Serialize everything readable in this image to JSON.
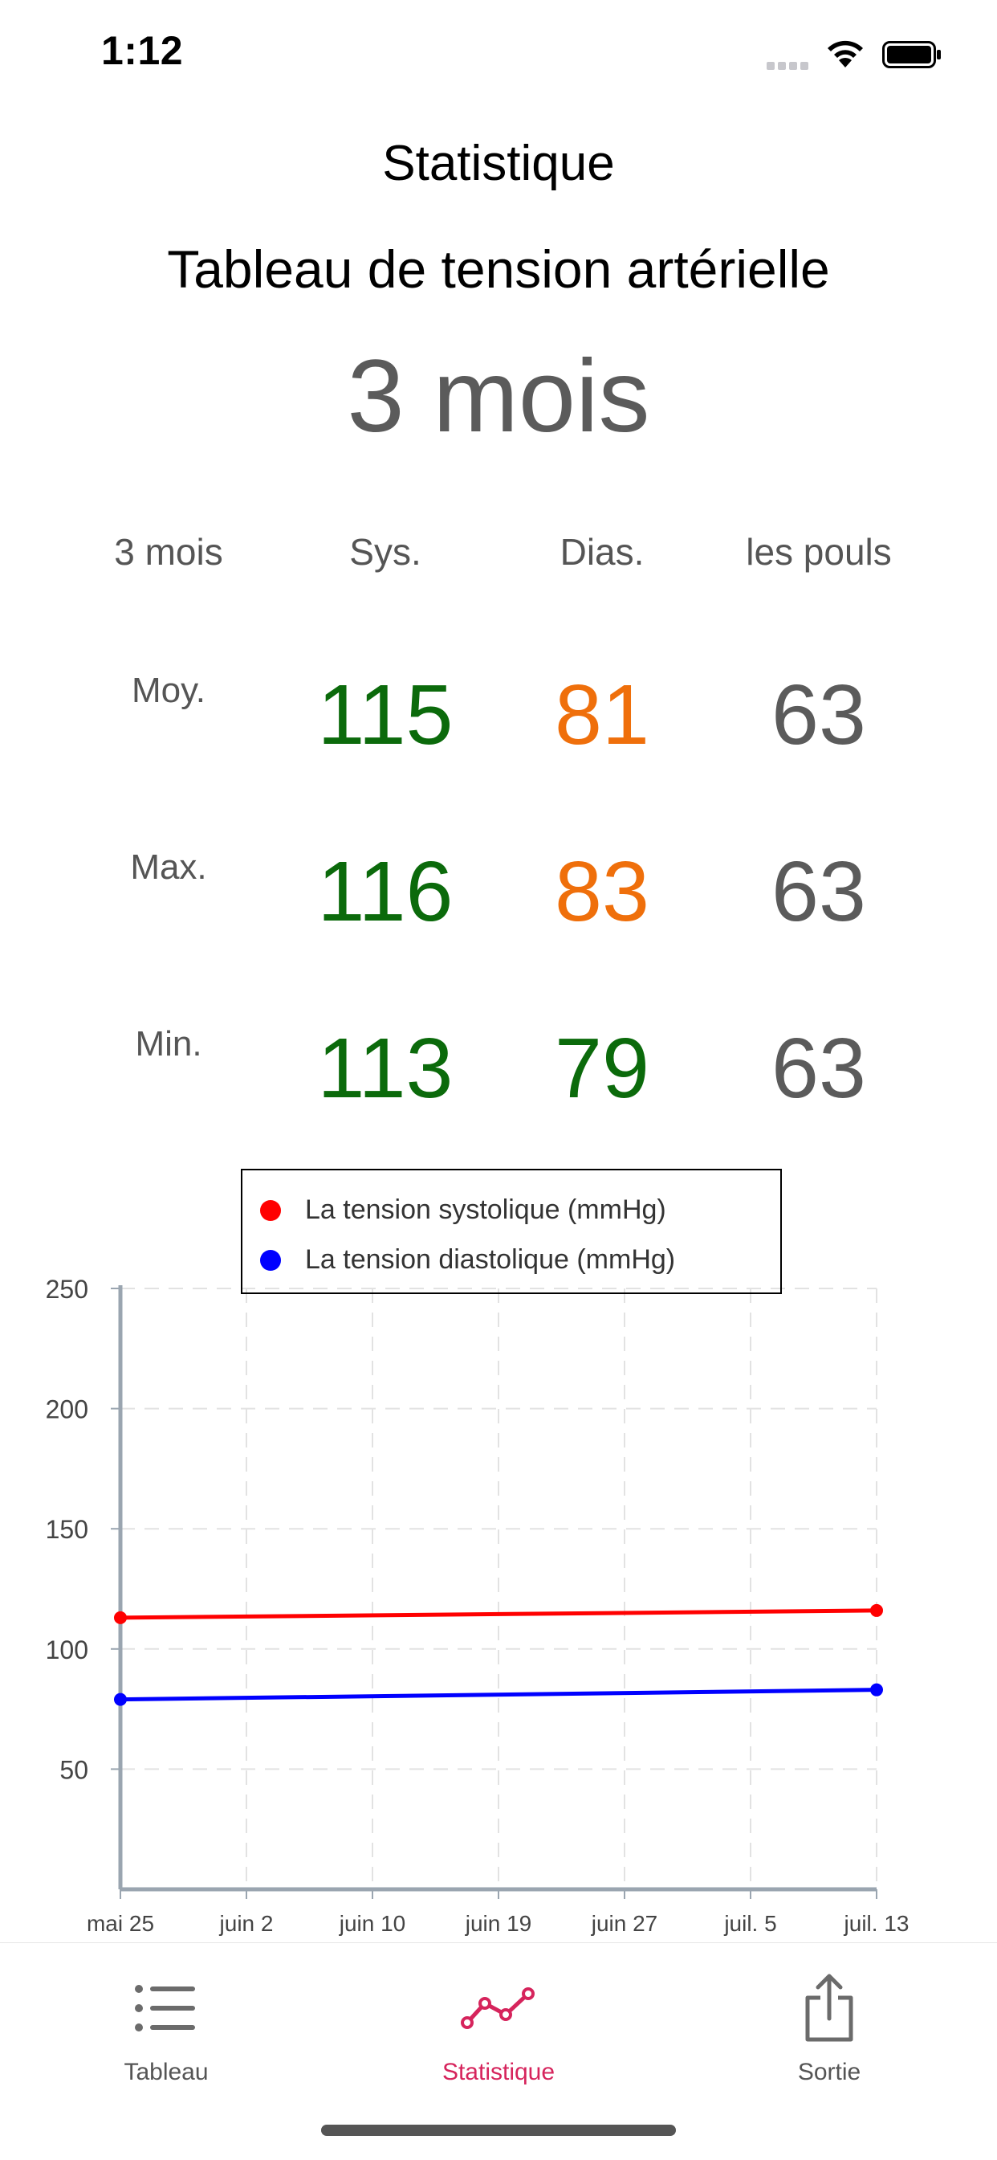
{
  "status_bar": {
    "time": "1:12"
  },
  "header": {
    "title": "Statistique",
    "chart_heading": "Tableau de tension artérielle",
    "period": "3 mois"
  },
  "stats": {
    "columns": [
      "3 mois",
      "Sys.",
      "Dias.",
      "les pouls"
    ],
    "rows": [
      {
        "label": "Moy.",
        "sys": "115",
        "dias": "81",
        "pulse": "63"
      },
      {
        "label": "Max.",
        "sys": "116",
        "dias": "83",
        "pulse": "63"
      },
      {
        "label": "Min.",
        "sys": "113",
        "dias": "79",
        "pulse": "63"
      }
    ],
    "colors": {
      "green": "#0b6a0b",
      "orange": "#ef6f0b",
      "gray": "#5b5b5b"
    }
  },
  "chart_data": {
    "type": "line",
    "title": "",
    "xlabel": "",
    "ylabel": "",
    "x_ticks": [
      "mai 25",
      "juin 2",
      "juin 10",
      "juin 19",
      "juin 27",
      "juil. 5",
      "juil. 13"
    ],
    "y_ticks": [
      250,
      200,
      150,
      100,
      50
    ],
    "ylim": [
      0,
      250
    ],
    "grid": true,
    "legend": "top-center",
    "series": [
      {
        "name": "La tension systolique (mmHg)",
        "color": "#ff0000",
        "x": [
          "mai 25",
          "juil. 13"
        ],
        "values": [
          113,
          116
        ]
      },
      {
        "name": "La tension diastolique (mmHg)",
        "color": "#0000ff",
        "x": [
          "mai 25",
          "juil. 13"
        ],
        "values": [
          79,
          83
        ]
      }
    ]
  },
  "tabbar": {
    "items": [
      {
        "label": "Tableau",
        "icon": "list-icon",
        "active": false
      },
      {
        "label": "Statistique",
        "icon": "line-chart-icon",
        "active": true
      },
      {
        "label": "Sortie",
        "icon": "share-icon",
        "active": false
      }
    ],
    "active_color": "#d6245c"
  }
}
